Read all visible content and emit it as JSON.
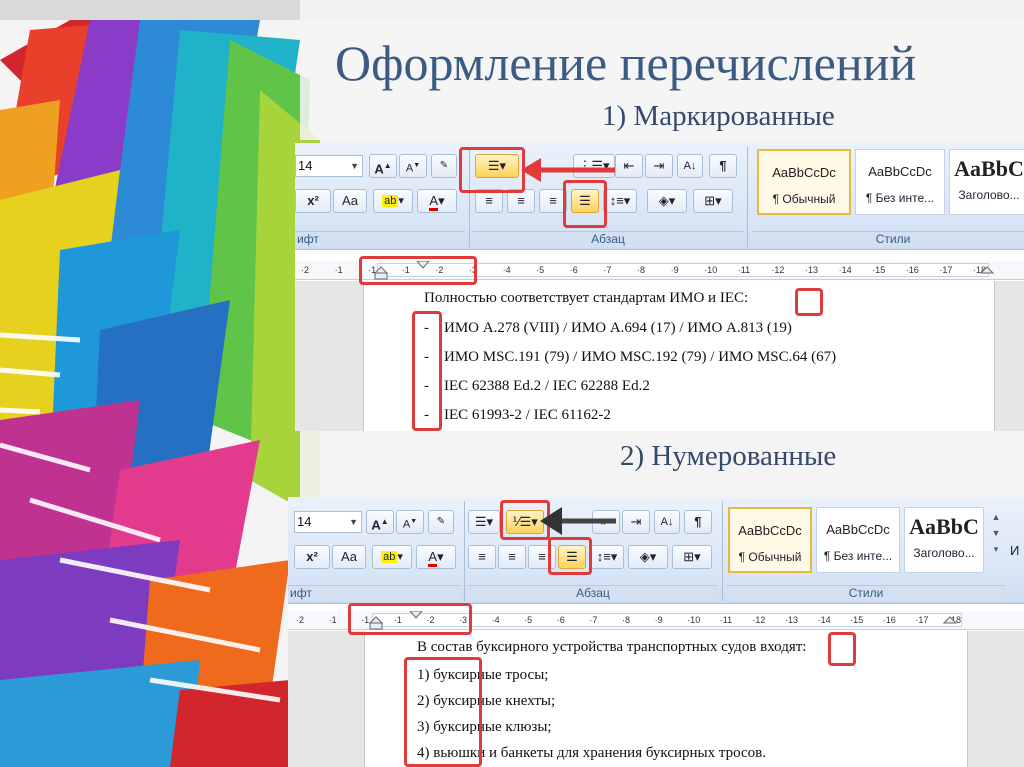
{
  "slide": {
    "title": "Оформление перечислений",
    "subtitle1": "1) Маркированные",
    "subtitle2": "2) Нумерованные"
  },
  "colors": {
    "title": "#3c5b84",
    "highlight": "#e03a3a",
    "ribbon": "#dbe7f6",
    "active_button": "#fcd25a"
  },
  "ribbon": {
    "font_size": "14",
    "font_group_label": "ифт",
    "paragraph_group_label": "Абзац",
    "styles_group_label": "Стили",
    "grow_font": "A",
    "shrink_font": "A",
    "superscript": "x²",
    "change_case": "Aa",
    "styles": [
      {
        "sample": "AaBbCcDc",
        "name": "¶ Обычный"
      },
      {
        "sample": "AaBbCcDc",
        "name": "¶ Без инте..."
      },
      {
        "sample": "AaBbC",
        "name": "Заголово..."
      }
    ],
    "paragraph_mark": "¶",
    "sort": "А↓"
  },
  "screenshot1": {
    "ruler_numbers": [
      "2",
      "1",
      "1",
      "1",
      "2",
      "3",
      "4",
      "5",
      "6",
      "7",
      "8",
      "9",
      "10",
      "11",
      "12",
      "13",
      "14",
      "15",
      "16",
      "17",
      "18"
    ],
    "intro": "Полностью соответствует стандартам ИМО и IEC:",
    "bullet": "-",
    "items": [
      "ИМО А.278 (VIII) / ИМО А.694 (17) / ИМО А.813 (19)",
      "ИМО MSC.191 (79) / ИМО MSC.192 (79) / ИМО MSC.64 (67)",
      "IEC 62388 Ed.2 / IEC 62288 Ed.2",
      "IEC 61993-2 / IEC 61162-2"
    ]
  },
  "screenshot2": {
    "ruler_numbers": [
      "2",
      "1",
      "1",
      "1",
      "2",
      "3",
      "4",
      "5",
      "6",
      "7",
      "8",
      "9",
      "10",
      "11",
      "12",
      "13",
      "14",
      "15",
      "16",
      "17",
      "18"
    ],
    "intro": "В состав буксирного устройства транспортных судов входят:",
    "items": [
      "1) буксирные тросы;",
      "2) буксирные кнехты;",
      "3) буксирные клюзы;",
      "4) вьюшки и банкеты для хранения буксирных тросов."
    ],
    "extra_label": "И"
  }
}
